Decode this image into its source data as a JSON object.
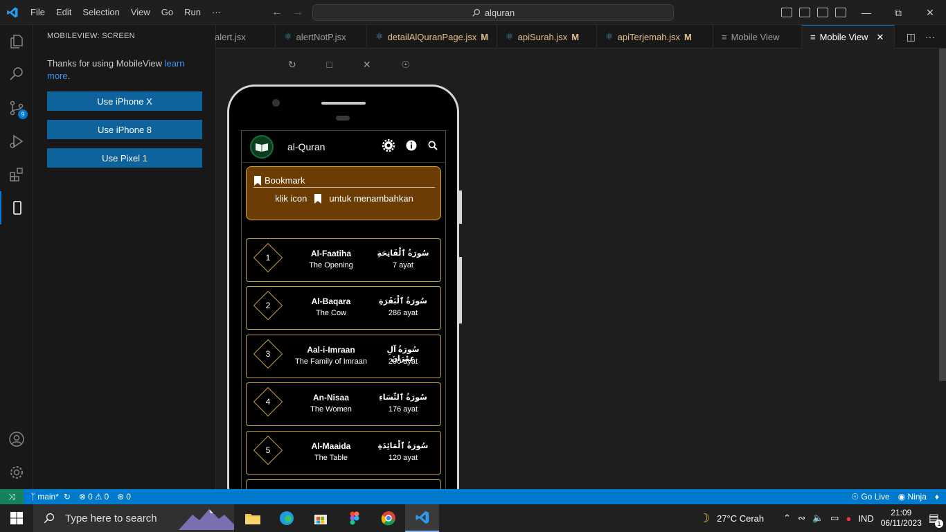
{
  "titlebar": {
    "menu": [
      "File",
      "Edit",
      "Selection",
      "View",
      "Go",
      "Run",
      "···"
    ],
    "search": "alquran"
  },
  "activity": {
    "scm_badge": "9"
  },
  "sidebar": {
    "header": "MOBILEVIEW: SCREEN",
    "message": "Thanks for using MobileView",
    "link": "learn more",
    "after_link": ".",
    "buttons": [
      "Use iPhone X",
      "Use iPhone 8",
      "Use Pixel 1"
    ]
  },
  "tabs": [
    {
      "label": "alert.jsx",
      "modified": "",
      "active": false
    },
    {
      "label": "alertNotP.jsx",
      "modified": "",
      "active": false
    },
    {
      "label": "detailAlQuranPage.jsx",
      "modified": "M",
      "active": false
    },
    {
      "label": "apiSurah.jsx",
      "modified": "M",
      "active": false
    },
    {
      "label": "apiTerjemah.jsx",
      "modified": "M",
      "active": false
    },
    {
      "label": "Mobile View",
      "modified": "",
      "active": false
    },
    {
      "label": "Mobile View",
      "modified": "",
      "active": true
    }
  ],
  "app": {
    "title": "al-Quran",
    "bookmark_title": "Bookmark",
    "bookmark_hint_prefix": "klik icon",
    "bookmark_hint_suffix": "untuk menambahkan",
    "surahs": [
      {
        "num": "1",
        "name": "Al-Faatiha",
        "trans": "The Opening",
        "arab": "سُورَةُ ٱلْفَاتِحَةِ",
        "ayat": "7 ayat"
      },
      {
        "num": "2",
        "name": "Al-Baqara",
        "trans": "The Cow",
        "arab": "سُورَةُ ٱلْبَقَرَةِ",
        "ayat": "286 ayat"
      },
      {
        "num": "3",
        "name": "Aal-i-Imraan",
        "trans": "The Family of Imraan",
        "arab": "سُورَةُ آلِ عِمْرَانَ",
        "ayat": "200 ayat"
      },
      {
        "num": "4",
        "name": "An-Nisaa",
        "trans": "The Women",
        "arab": "سُورَةُ ٱلنِّسَاءِ",
        "ayat": "176 ayat"
      },
      {
        "num": "5",
        "name": "Al-Maaida",
        "trans": "The Table",
        "arab": "سُورَةُ ٱلْمَائِدَةِ",
        "ayat": "120 ayat"
      }
    ]
  },
  "statusbar": {
    "branch": "main*",
    "errors": "0",
    "warnings": "0",
    "ports": "0",
    "golive": "Go Live",
    "ninja": "Ninja"
  },
  "taskbar": {
    "search_placeholder": "Type here to search",
    "weather": "27°C  Cerah",
    "lang": "IND",
    "time": "21:09",
    "date": "06/11/2023",
    "notif_count": "1"
  },
  "colors": {
    "accent": "#0078d4",
    "statusbar": "#007acc",
    "bookmark_bg": "#6b3d05",
    "surah_border": "#c4a040"
  }
}
